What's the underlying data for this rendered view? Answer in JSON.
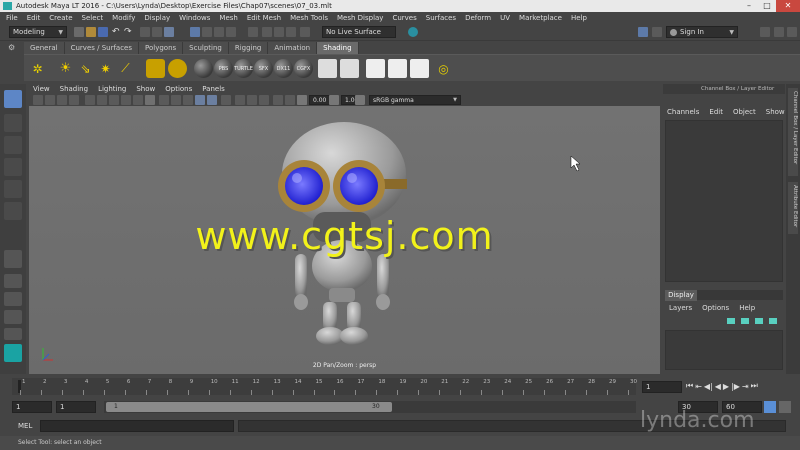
{
  "titlebar": {
    "title": "Autodesk Maya LT 2016 - C:\\Users\\Lynda\\Desktop\\Exercise Files\\Chap07\\scenes\\07_03.mlt",
    "minimize": "–",
    "maximize": "□",
    "close": "✕"
  },
  "menubar": [
    "File",
    "Edit",
    "Create",
    "Select",
    "Modify",
    "Display",
    "Windows",
    "Mesh",
    "Edit Mesh",
    "Mesh Tools",
    "Mesh Display",
    "Curves",
    "Surfaces",
    "Deform",
    "UV",
    "Marketplace",
    "Help"
  ],
  "statusline": {
    "workspace": "Modeling",
    "live_surface": "No Live Surface",
    "sign_in": "Sign In"
  },
  "shelf": {
    "tabs": [
      "General",
      "Curves / Surfaces",
      "Polygons",
      "Sculpting",
      "Rigging",
      "Animation",
      "Shading"
    ],
    "active_tab": "Shading",
    "shader_labels": [
      "PBS",
      "TURTLE",
      "SFX",
      "DX11",
      "CGFX"
    ]
  },
  "viewport": {
    "menu": [
      "View",
      "Shading",
      "Lighting",
      "Show",
      "Options",
      "Panels"
    ],
    "exposure": "0.00",
    "gamma": "1.00",
    "color_space": "sRGB gamma",
    "camera_label": "2D Pan/Zoom : persp",
    "watermark": "www.cgtsj.com"
  },
  "channelbox": {
    "header": "Channel Box / Layer Editor",
    "menu": [
      "Channels",
      "Edit",
      "Object",
      "Show"
    ],
    "display_tab": "Display",
    "layer_menu": [
      "Layers",
      "Options",
      "Help"
    ]
  },
  "sidetabs": [
    "Channel Box / Layer Editor",
    "Attribute Editor"
  ],
  "timeslider": {
    "ticks": [
      "1",
      "2",
      "3",
      "4",
      "5",
      "6",
      "7",
      "8",
      "9",
      "10",
      "11",
      "12",
      "13",
      "14",
      "15",
      "16",
      "17",
      "18",
      "19",
      "20",
      "21",
      "22",
      "23",
      "24",
      "25",
      "26",
      "27",
      "28",
      "29",
      "30"
    ],
    "current_frame": "1"
  },
  "range": {
    "start": "1",
    "start_inner": "1",
    "range_start_label": "1",
    "range_end_label": "30",
    "end_inner": "30",
    "end": "60"
  },
  "mel": {
    "label": "MEL"
  },
  "helpline": "Select Tool: select an object",
  "brand_watermark": "lynda.com",
  "colors": {
    "accent": "#5a8fd6",
    "watermark_yellow": "#f2f21a",
    "goggle_lens": "#3c3cf0",
    "goggle_rim": "#a8843a"
  }
}
